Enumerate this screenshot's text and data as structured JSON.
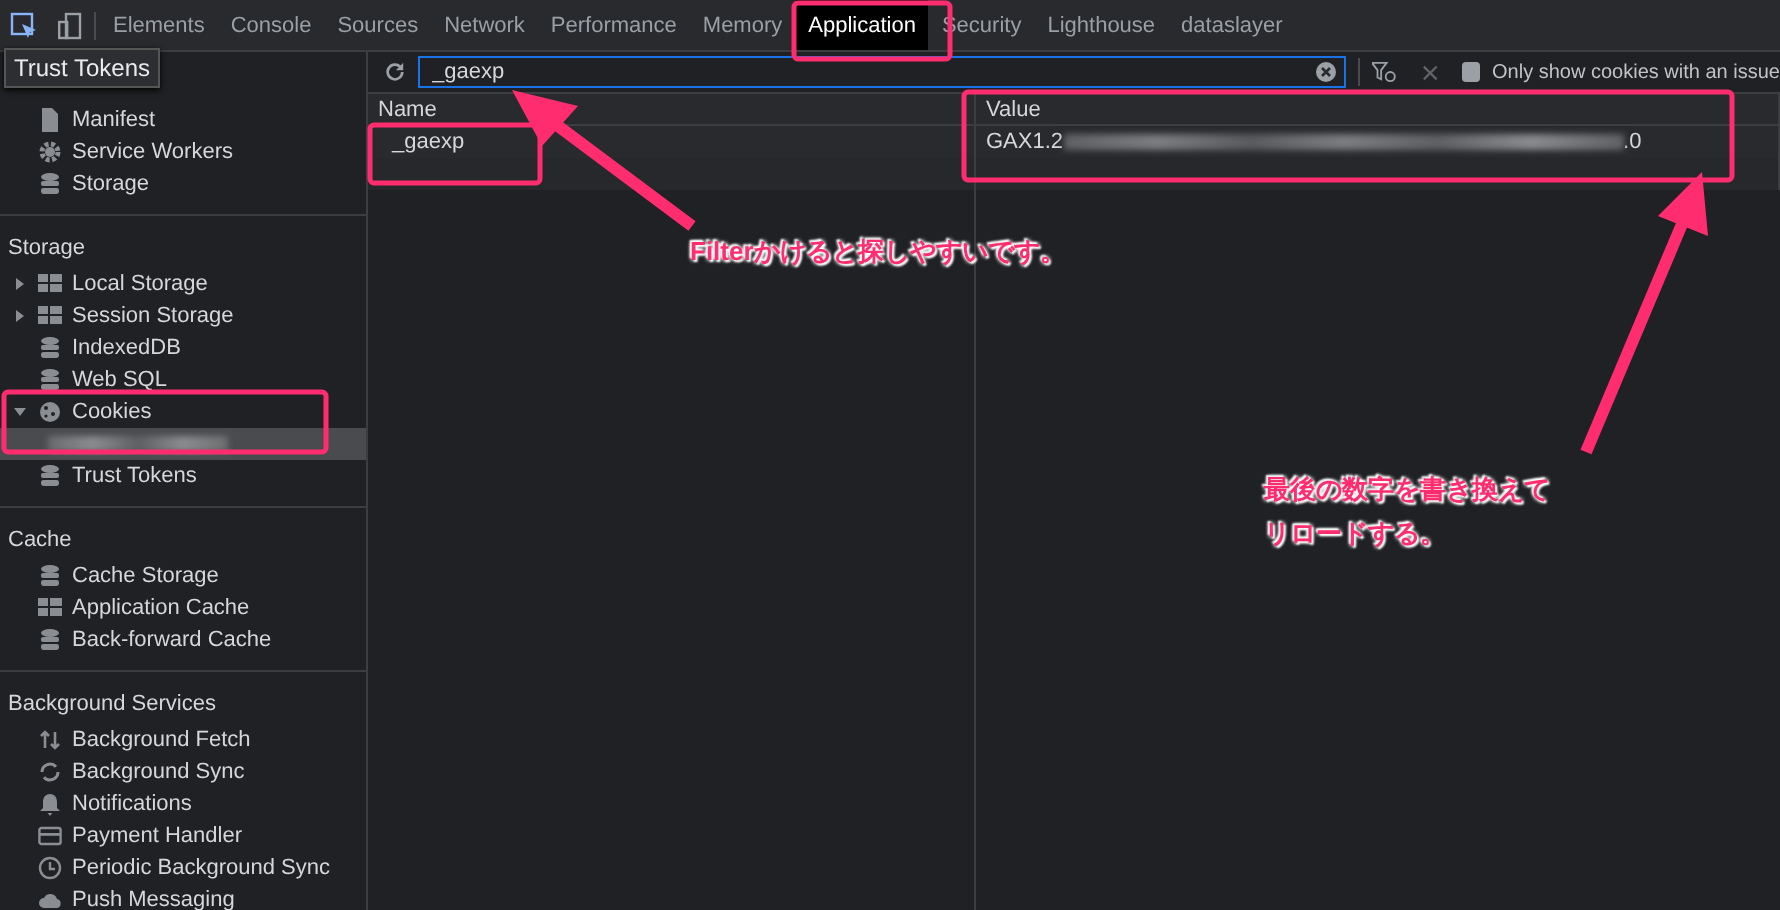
{
  "tabs": [
    {
      "label": "Elements",
      "selected": false
    },
    {
      "label": "Console",
      "selected": false
    },
    {
      "label": "Sources",
      "selected": false
    },
    {
      "label": "Network",
      "selected": false
    },
    {
      "label": "Performance",
      "selected": false
    },
    {
      "label": "Memory",
      "selected": false
    },
    {
      "label": "Application",
      "selected": true
    },
    {
      "label": "Security",
      "selected": false
    },
    {
      "label": "Lighthouse",
      "selected": false
    },
    {
      "label": "dataslayer",
      "selected": false
    }
  ],
  "tooltip": "Trust Tokens",
  "sidebar": {
    "sections": [
      {
        "items": [
          {
            "label": "Manifest",
            "kind": "file"
          },
          {
            "label": "Service Workers",
            "kind": "gear"
          },
          {
            "label": "Storage",
            "kind": "db"
          }
        ]
      },
      {
        "title": "Storage",
        "items": [
          {
            "label": "Local Storage",
            "kind": "grid",
            "expanded": false
          },
          {
            "label": "Session Storage",
            "kind": "grid",
            "expanded": false
          },
          {
            "label": "IndexedDB",
            "kind": "db"
          },
          {
            "label": "Web SQL",
            "kind": "db"
          },
          {
            "label": "Cookies",
            "kind": "cookie",
            "expanded": true,
            "children": [
              {
                "kind": "redacted",
                "selected": true
              }
            ]
          },
          {
            "label": "Trust Tokens",
            "kind": "db"
          }
        ]
      },
      {
        "title": "Cache",
        "items": [
          {
            "label": "Cache Storage",
            "kind": "db"
          },
          {
            "label": "Application Cache",
            "kind": "grid"
          },
          {
            "label": "Back-forward Cache",
            "kind": "db"
          }
        ]
      },
      {
        "title": "Background Services",
        "items": [
          {
            "label": "Background Fetch",
            "kind": "arrows"
          },
          {
            "label": "Background Sync",
            "kind": "sync"
          },
          {
            "label": "Notifications",
            "kind": "bell"
          },
          {
            "label": "Payment Handler",
            "kind": "card"
          },
          {
            "label": "Periodic Background Sync",
            "kind": "clock"
          },
          {
            "label": "Push Messaging",
            "kind": "cloud"
          }
        ]
      }
    ]
  },
  "toolbar": {
    "filter": "_gaexp",
    "issue_only": {
      "label": "Only show cookies with an issue",
      "checked": false
    }
  },
  "table": {
    "columns": [
      "Name",
      "Value"
    ],
    "rows": [
      {
        "name": "_gaexp",
        "value_start": "GAX1.2",
        "value_end": ".0",
        "selected": false
      }
    ]
  },
  "annotations": [
    {
      "text": "Filterかけると探しやすいです。"
    },
    {
      "text": "最後の数字を書き換えてリロードする。"
    }
  ]
}
